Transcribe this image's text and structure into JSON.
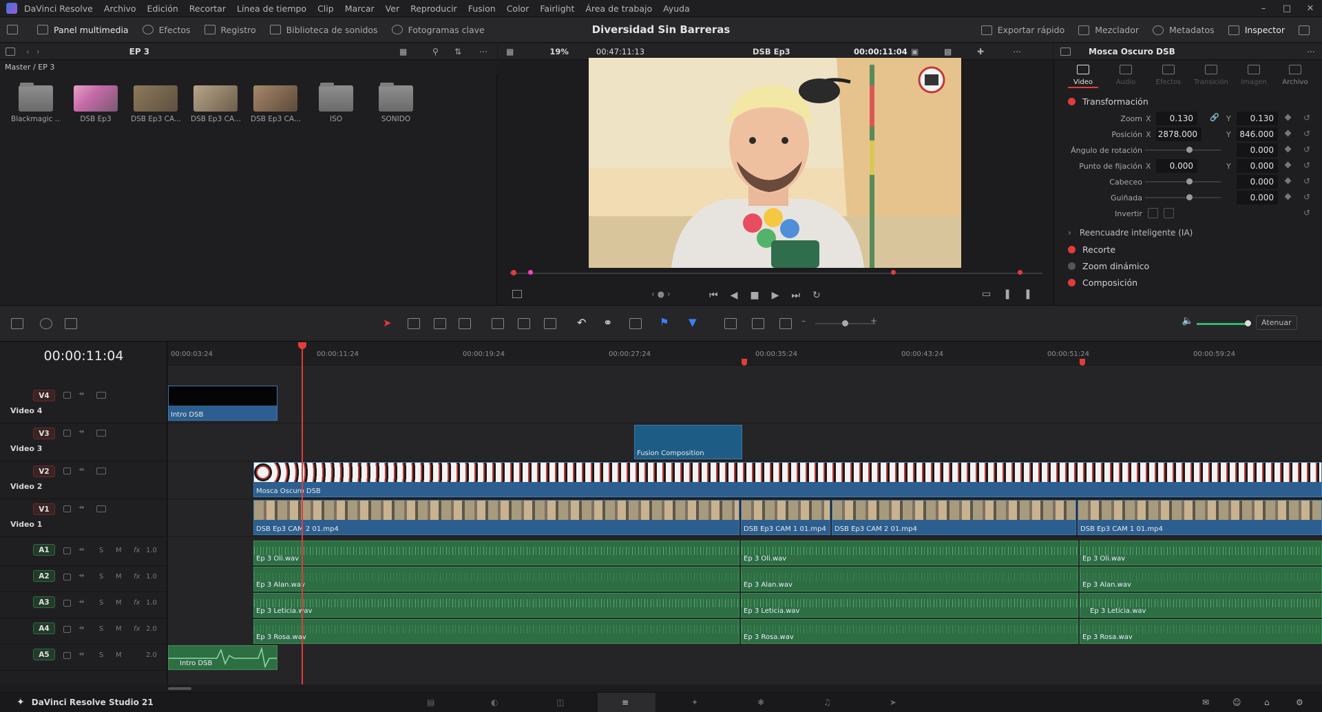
{
  "menubar": {
    "items": [
      "DaVinci Resolve",
      "Archivo",
      "Edición",
      "Recortar",
      "Línea de tiempo",
      "Clip",
      "Marcar",
      "Ver",
      "Reproducir",
      "Fusion",
      "Color",
      "Fairlight",
      "Área de trabajo",
      "Ayuda"
    ]
  },
  "toolbar": {
    "left": [
      "Panel multimedia",
      "Efectos",
      "Registro",
      "Biblioteca de sonidos",
      "Fotogramas clave"
    ],
    "title": "Diversidad Sin Barreras",
    "right": [
      "Exportar rápido",
      "Mezclador",
      "Metadatos",
      "Inspector"
    ]
  },
  "mediapool": {
    "bin_name": "EP 3",
    "path": "Master / EP 3",
    "clips": [
      {
        "label": "Blackmagic ...",
        "kind": "folder"
      },
      {
        "label": "DSB Ep3",
        "kind": "timeline"
      },
      {
        "label": "DSB Ep3 CA...",
        "kind": "video"
      },
      {
        "label": "DSB Ep3 CA...",
        "kind": "video"
      },
      {
        "label": "DSB Ep3 CA...",
        "kind": "video"
      },
      {
        "label": "ISO",
        "kind": "folder"
      },
      {
        "label": "SONIDO",
        "kind": "folder"
      }
    ]
  },
  "viewer": {
    "zoom": "19%",
    "duration": "00:47:11:13",
    "timeline_name": "DSB Ep3",
    "timecode": "00:00:11:04"
  },
  "inspector": {
    "clip_name": "Mosca Oscuro DSB",
    "tabs": [
      "Video",
      "Audio",
      "Efectos",
      "Transición",
      "Imagen",
      "Archivo"
    ],
    "active_tab": "Video",
    "sections": {
      "transform": "Transformación",
      "smart_reframe": "Reencuadre inteligente (IA)",
      "crop": "Recorte",
      "dynamic_zoom": "Zoom dinámico",
      "composite": "Composición"
    },
    "params": {
      "zoom_label": "Zoom",
      "zoom_x": "0.130",
      "zoom_y": "0.130",
      "position_label": "Posición",
      "position_x": "2878.000",
      "position_y": "846.000",
      "rotation_label": "Ángulo de rotación",
      "rotation": "0.000",
      "anchor_label": "Punto de fijación",
      "anchor_x": "0.000",
      "anchor_y": "0.000",
      "pitch_label": "Cabeceo",
      "pitch": "0.000",
      "yaw_label": "Guiñada",
      "yaw": "0.000",
      "flip_label": "Invertir",
      "x": "X",
      "y": "Y"
    }
  },
  "timeline": {
    "timecode": "00:00:11:04",
    "ruler": [
      "00:00:03:24",
      "00:00:11:24",
      "00:00:19:24",
      "00:00:27:24",
      "00:00:35:24",
      "00:00:43:24",
      "00:00:51:24",
      "00:00:59:24"
    ],
    "volume_label": "Atenuar",
    "video_tracks": [
      {
        "id": "V4",
        "name": "Video 4"
      },
      {
        "id": "V3",
        "name": "Video 3"
      },
      {
        "id": "V2",
        "name": "Video 2"
      },
      {
        "id": "V1",
        "name": "Video 1"
      }
    ],
    "audio_tracks": [
      {
        "id": "A1",
        "gain": "1.0"
      },
      {
        "id": "A2",
        "gain": "1.0"
      },
      {
        "id": "A3",
        "gain": "1.0"
      },
      {
        "id": "A4",
        "gain": "2.0"
      },
      {
        "id": "A5",
        "gain": "2.0"
      }
    ],
    "clips": {
      "v4": "Intro DSB",
      "v3": "Fusion Composition",
      "v2": "Mosca Oscuro DSB",
      "v1": [
        "DSB Ep3 CAM 2 01.mp4",
        "DSB Ep3 CAM 1 01.mp4",
        "DSB Ep3 CAM 2 01.mp4",
        "DSB Ep3 CAM 1 01.mp4"
      ],
      "a1": [
        "Ep 3 Oli.wav",
        "Ep 3 Oli.wav",
        "Ep 3 Oli.wav"
      ],
      "a2": [
        "Ep 3 Alan.wav",
        "Ep 3 Alan.wav",
        "Ep 3 Alan.wav"
      ],
      "a3": [
        "Ep 3 Leticia.wav",
        "Ep 3 Leticia.wav",
        "Ep 3 Leticia.wav"
      ],
      "a4": [
        "Ep 3 Rosa.wav",
        "Ep 3 Rosa.wav",
        "Ep 3 Rosa.wav"
      ],
      "a5": "Intro DSB"
    },
    "track_btn_s": "S",
    "track_btn_m": "M",
    "fx": "fx"
  },
  "bottom": {
    "app_name": "DaVinci Resolve Studio 21"
  },
  "colors": {
    "accent_red": "#e23c3c",
    "video_clip": "#2c5f8f",
    "audio_clip": "#2d6e43"
  }
}
